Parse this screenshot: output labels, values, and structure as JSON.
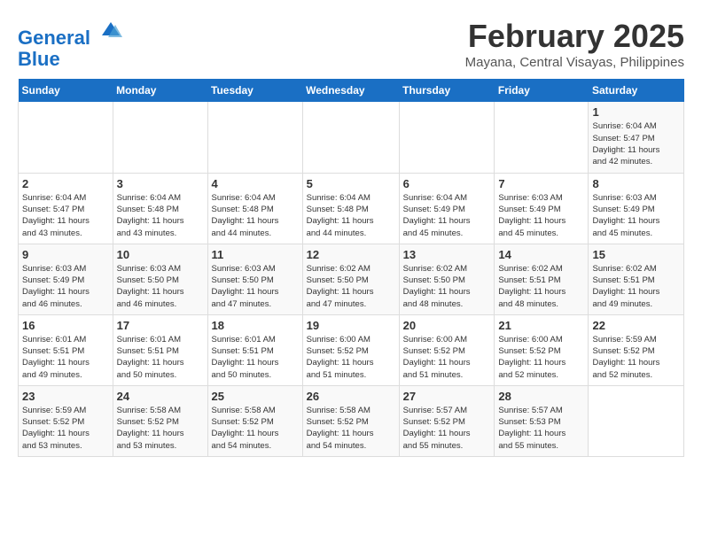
{
  "header": {
    "logo_line1": "General",
    "logo_line2": "Blue",
    "month": "February 2025",
    "location": "Mayana, Central Visayas, Philippines"
  },
  "days_of_week": [
    "Sunday",
    "Monday",
    "Tuesday",
    "Wednesday",
    "Thursday",
    "Friday",
    "Saturday"
  ],
  "weeks": [
    [
      {
        "day": "",
        "info": ""
      },
      {
        "day": "",
        "info": ""
      },
      {
        "day": "",
        "info": ""
      },
      {
        "day": "",
        "info": ""
      },
      {
        "day": "",
        "info": ""
      },
      {
        "day": "",
        "info": ""
      },
      {
        "day": "1",
        "info": "Sunrise: 6:04 AM\nSunset: 5:47 PM\nDaylight: 11 hours\nand 42 minutes."
      }
    ],
    [
      {
        "day": "2",
        "info": "Sunrise: 6:04 AM\nSunset: 5:47 PM\nDaylight: 11 hours\nand 43 minutes."
      },
      {
        "day": "3",
        "info": "Sunrise: 6:04 AM\nSunset: 5:48 PM\nDaylight: 11 hours\nand 43 minutes."
      },
      {
        "day": "4",
        "info": "Sunrise: 6:04 AM\nSunset: 5:48 PM\nDaylight: 11 hours\nand 44 minutes."
      },
      {
        "day": "5",
        "info": "Sunrise: 6:04 AM\nSunset: 5:48 PM\nDaylight: 11 hours\nand 44 minutes."
      },
      {
        "day": "6",
        "info": "Sunrise: 6:04 AM\nSunset: 5:49 PM\nDaylight: 11 hours\nand 45 minutes."
      },
      {
        "day": "7",
        "info": "Sunrise: 6:03 AM\nSunset: 5:49 PM\nDaylight: 11 hours\nand 45 minutes."
      },
      {
        "day": "8",
        "info": "Sunrise: 6:03 AM\nSunset: 5:49 PM\nDaylight: 11 hours\nand 45 minutes."
      }
    ],
    [
      {
        "day": "9",
        "info": "Sunrise: 6:03 AM\nSunset: 5:49 PM\nDaylight: 11 hours\nand 46 minutes."
      },
      {
        "day": "10",
        "info": "Sunrise: 6:03 AM\nSunset: 5:50 PM\nDaylight: 11 hours\nand 46 minutes."
      },
      {
        "day": "11",
        "info": "Sunrise: 6:03 AM\nSunset: 5:50 PM\nDaylight: 11 hours\nand 47 minutes."
      },
      {
        "day": "12",
        "info": "Sunrise: 6:02 AM\nSunset: 5:50 PM\nDaylight: 11 hours\nand 47 minutes."
      },
      {
        "day": "13",
        "info": "Sunrise: 6:02 AM\nSunset: 5:50 PM\nDaylight: 11 hours\nand 48 minutes."
      },
      {
        "day": "14",
        "info": "Sunrise: 6:02 AM\nSunset: 5:51 PM\nDaylight: 11 hours\nand 48 minutes."
      },
      {
        "day": "15",
        "info": "Sunrise: 6:02 AM\nSunset: 5:51 PM\nDaylight: 11 hours\nand 49 minutes."
      }
    ],
    [
      {
        "day": "16",
        "info": "Sunrise: 6:01 AM\nSunset: 5:51 PM\nDaylight: 11 hours\nand 49 minutes."
      },
      {
        "day": "17",
        "info": "Sunrise: 6:01 AM\nSunset: 5:51 PM\nDaylight: 11 hours\nand 50 minutes."
      },
      {
        "day": "18",
        "info": "Sunrise: 6:01 AM\nSunset: 5:51 PM\nDaylight: 11 hours\nand 50 minutes."
      },
      {
        "day": "19",
        "info": "Sunrise: 6:00 AM\nSunset: 5:52 PM\nDaylight: 11 hours\nand 51 minutes."
      },
      {
        "day": "20",
        "info": "Sunrise: 6:00 AM\nSunset: 5:52 PM\nDaylight: 11 hours\nand 51 minutes."
      },
      {
        "day": "21",
        "info": "Sunrise: 6:00 AM\nSunset: 5:52 PM\nDaylight: 11 hours\nand 52 minutes."
      },
      {
        "day": "22",
        "info": "Sunrise: 5:59 AM\nSunset: 5:52 PM\nDaylight: 11 hours\nand 52 minutes."
      }
    ],
    [
      {
        "day": "23",
        "info": "Sunrise: 5:59 AM\nSunset: 5:52 PM\nDaylight: 11 hours\nand 53 minutes."
      },
      {
        "day": "24",
        "info": "Sunrise: 5:58 AM\nSunset: 5:52 PM\nDaylight: 11 hours\nand 53 minutes."
      },
      {
        "day": "25",
        "info": "Sunrise: 5:58 AM\nSunset: 5:52 PM\nDaylight: 11 hours\nand 54 minutes."
      },
      {
        "day": "26",
        "info": "Sunrise: 5:58 AM\nSunset: 5:52 PM\nDaylight: 11 hours\nand 54 minutes."
      },
      {
        "day": "27",
        "info": "Sunrise: 5:57 AM\nSunset: 5:52 PM\nDaylight: 11 hours\nand 55 minutes."
      },
      {
        "day": "28",
        "info": "Sunrise: 5:57 AM\nSunset: 5:53 PM\nDaylight: 11 hours\nand 55 minutes."
      },
      {
        "day": "",
        "info": ""
      }
    ]
  ]
}
